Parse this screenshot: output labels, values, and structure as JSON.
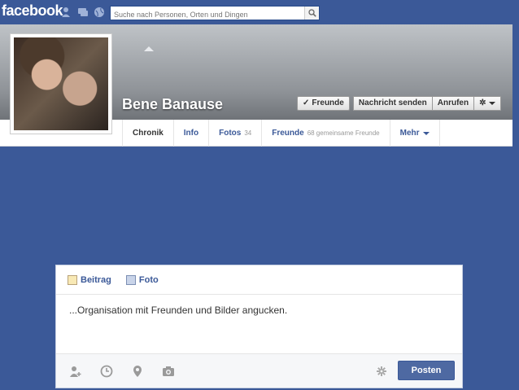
{
  "header": {
    "logo": "facebook",
    "search_placeholder": "Suche nach Personen, Orten und Dingen"
  },
  "profile": {
    "name": "Bene Banause",
    "actions": {
      "friends_label": "Freunde",
      "message_label": "Nachricht senden",
      "call_label": "Anrufen"
    },
    "tabs": [
      {
        "label": "Chronik"
      },
      {
        "label": "Info"
      },
      {
        "label": "Fotos",
        "count": "34"
      },
      {
        "label": "Freunde",
        "count": "68 gemeinsame Freunde"
      },
      {
        "label": "Mehr"
      }
    ]
  },
  "composer": {
    "tabs": [
      {
        "label": "Beitrag"
      },
      {
        "label": "Foto"
      }
    ],
    "text": "...Organisation mit Freunden und Bilder angucken.",
    "post_label": "Posten"
  },
  "colors": {
    "brand": "#3b5998",
    "post_button": "#4e69a2"
  }
}
